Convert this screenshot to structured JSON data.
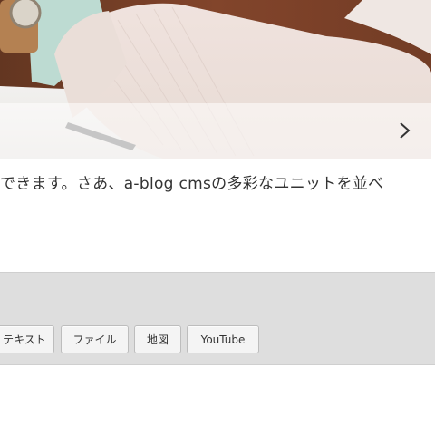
{
  "hero": {
    "next_icon": "chevron-right-icon"
  },
  "body": {
    "text": "できます。さあ、a-blog cmsの多彩なユニットを並べ"
  },
  "unit_toolbar": {
    "buttons": [
      {
        "label": "テキスト"
      },
      {
        "label": "ファイル"
      },
      {
        "label": "地図"
      },
      {
        "label": "YouTube"
      }
    ]
  },
  "colors": {
    "toolbar_bg": "#dedede",
    "button_bg": "#f4f4f4",
    "text": "#333333"
  }
}
